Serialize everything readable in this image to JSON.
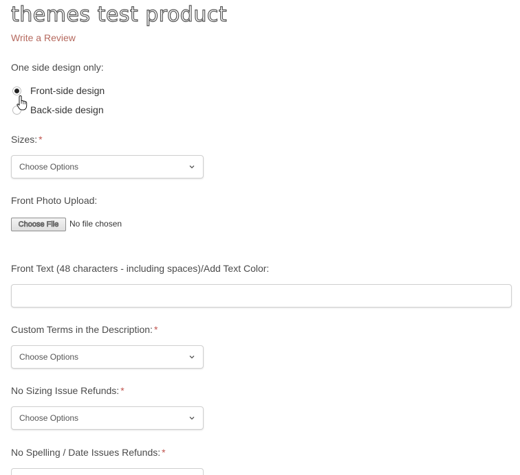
{
  "product": {
    "title": "themes test product",
    "review_link": "Write a Review"
  },
  "design_option": {
    "label": "One side design only:",
    "options": [
      "Front-side design",
      "Back-side design"
    ],
    "selected": "Front-side design"
  },
  "sizes": {
    "label": "Sizes:",
    "required_mark": "*",
    "value": "Choose Options"
  },
  "front_photo": {
    "label": "Front Photo Upload:",
    "button_label": "Choose File",
    "status": "No file chosen"
  },
  "front_text": {
    "label": "Front Text (48 characters - including spaces)/Add Text Color:",
    "value": ""
  },
  "custom_terms": {
    "label": "Custom Terms in the Description:",
    "required_mark": "*",
    "value": "Choose Options"
  },
  "sizing_refunds": {
    "label": "No Sizing Issue Refunds:",
    "required_mark": "*",
    "value": "Choose Options"
  },
  "spelling_refunds": {
    "label": "No Spelling / Date Issues Refunds:",
    "required_mark": "*"
  },
  "colors": {
    "link": "#b5695e",
    "required": "#c0544e"
  }
}
